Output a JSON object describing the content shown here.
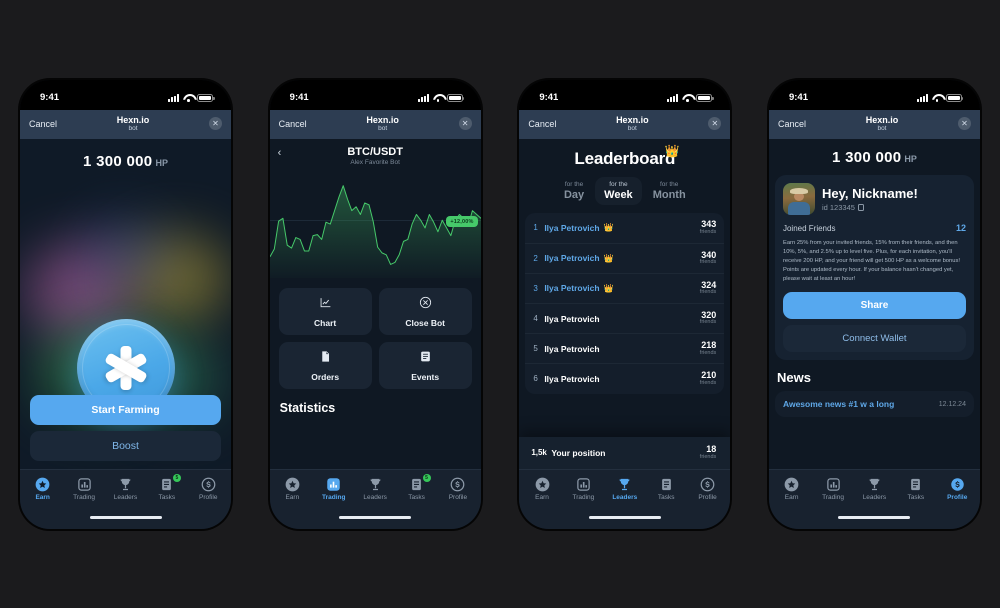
{
  "status_bar": {
    "time": "9:41",
    "signal": "signal-bars",
    "wifi": "wifi-icon",
    "battery": "battery-icon"
  },
  "nav": {
    "cancel": "Cancel",
    "title": "Hexn.io",
    "subtitle": "bot",
    "close": "✕"
  },
  "tabs": [
    {
      "label": "Earn",
      "icon": "star-icon"
    },
    {
      "label": "Trading",
      "icon": "bar-chart-icon"
    },
    {
      "label": "Leaders",
      "icon": "trophy-icon"
    },
    {
      "label": "Tasks",
      "icon": "clipboard-icon",
      "badge": "5"
    },
    {
      "label": "Profile",
      "icon": "dollar-circle-icon"
    }
  ],
  "screen1": {
    "balance_value": "1 300 000",
    "balance_unit": "HP",
    "coin_icon": "asterisk-coin-icon",
    "primary_button": "Start Farming",
    "secondary_button": "Boost",
    "active_tab": "Earn"
  },
  "screen2": {
    "back_icon": "chevron-left-icon",
    "pair": "BTC/USDT",
    "pair_subtitle": "Alex Favorite Bot",
    "change_badge": "+12,00%",
    "actions": [
      {
        "label": "Chart",
        "icon": "line-chart-icon"
      },
      {
        "label": "Close Bot",
        "icon": "close-circle-icon"
      },
      {
        "label": "Orders",
        "icon": "document-icon"
      },
      {
        "label": "Events",
        "icon": "list-box-icon"
      }
    ],
    "section_title": "Statistics",
    "active_tab": "Trading",
    "chart_data": {
      "type": "area",
      "title": "BTC/USDT",
      "series_name": "BTC/USDT price",
      "change_pct": "+12,00%",
      "color": "#46c96a",
      "x": [
        0,
        1,
        2,
        3,
        4,
        5,
        6,
        7,
        8,
        9,
        10,
        11,
        12,
        13,
        14,
        15,
        16,
        17,
        18,
        19,
        20,
        21,
        22,
        23,
        24,
        25,
        26,
        27,
        28,
        29,
        30,
        31,
        32,
        33,
        34,
        35,
        36,
        37,
        38,
        39,
        40,
        41,
        42,
        43,
        44,
        45,
        46,
        47,
        48,
        49
      ],
      "values": [
        18,
        26,
        55,
        58,
        30,
        27,
        38,
        36,
        24,
        24,
        40,
        41,
        36,
        54,
        52,
        66,
        80,
        92,
        78,
        66,
        70,
        62,
        74,
        72,
        54,
        28,
        22,
        20,
        10,
        12,
        20,
        34,
        36,
        52,
        62,
        56,
        48,
        62,
        54,
        44,
        56,
        48,
        40,
        56,
        62,
        58,
        50,
        66,
        62,
        58
      ],
      "ylim": [
        0,
        100
      ],
      "grid": false,
      "reference_line": 56
    }
  },
  "screen3": {
    "title": "Leaderboard",
    "title_emoji": "👑",
    "segments": [
      {
        "top": "for the",
        "bottom": "Day",
        "selected": false
      },
      {
        "top": "for the",
        "bottom": "Week",
        "selected": true
      },
      {
        "top": "for the",
        "bottom": "Month",
        "selected": false
      }
    ],
    "unit": "friends",
    "rows": [
      {
        "rank": "1",
        "name": "Ilya Petrovich",
        "crown": "👑",
        "value": "343",
        "unit": "friends",
        "top": true
      },
      {
        "rank": "2",
        "name": "Ilya Petrovich",
        "crown": "👑",
        "value": "340",
        "unit": "friends",
        "top": true
      },
      {
        "rank": "3",
        "name": "Ilya Petrovich",
        "crown": "👑",
        "value": "324",
        "unit": "friends",
        "top": true
      },
      {
        "rank": "4",
        "name": "Ilya Petrovich",
        "crown": "",
        "value": "320",
        "unit": "friends",
        "top": false
      },
      {
        "rank": "5",
        "name": "Ilya Petrovich",
        "crown": "",
        "value": "218",
        "unit": "friends",
        "top": false
      },
      {
        "rank": "6",
        "name": "Ilya Petrovich",
        "crown": "",
        "value": "210",
        "unit": "friends",
        "top": false
      }
    ],
    "your_position": {
      "rank": "1,5k",
      "name": "Your position",
      "value": "18",
      "unit": "friends"
    },
    "active_tab": "Leaders"
  },
  "screen4": {
    "balance_value": "1 300 000",
    "balance_unit": "HP",
    "greeting": "Hey, Nickname!",
    "id": "id 123345",
    "copy_icon": "copy-icon",
    "avatar": "user-avatar",
    "joined_label": "Joined Friends",
    "joined_count": "12",
    "referral_text": "Earn 25% from your invited friends, 15% from their friends, and then 10%, 5%, and 2.5% up to level five. Plus, for each invitation, you'll receive 200 HP, and your friend will get 500 HP as a welcome bonus! Points are updated every hour. If your balance hasn't changed yet, please wait at least an hour!",
    "share_button": "Share",
    "wallet_button": "Connect Wallet",
    "news_title": "News",
    "news_item": {
      "headline": "Awesome news #1 w a long",
      "date": "12.12.24"
    },
    "active_tab": "Profile"
  },
  "theme": {
    "accent": "#56a8ef",
    "green": "#46c96a",
    "bg": "#1b1b1d",
    "screen_bg": "#0f1823",
    "nav_bg": "#2d3d52"
  }
}
